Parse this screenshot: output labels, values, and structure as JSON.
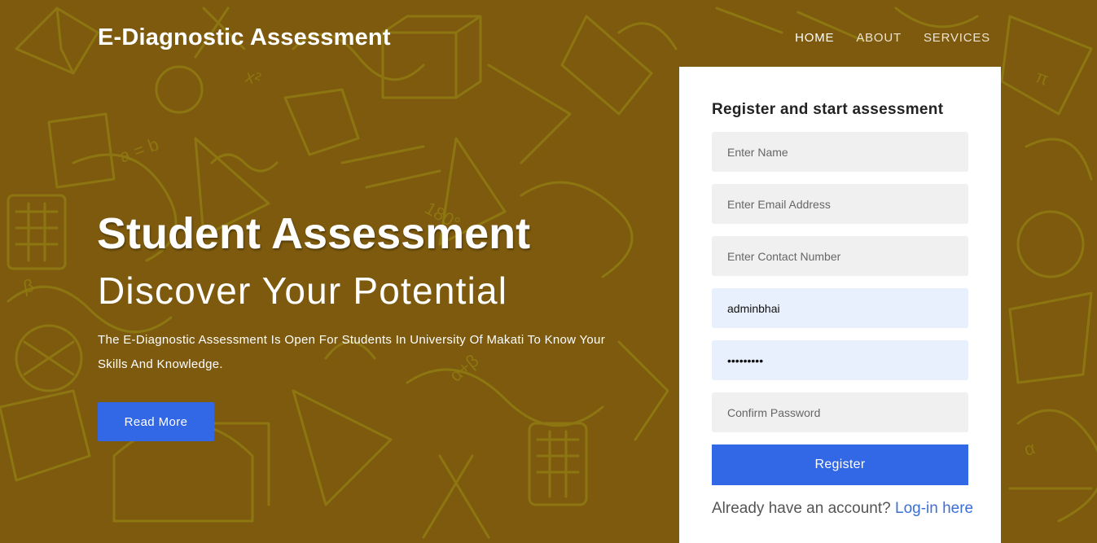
{
  "header": {
    "brand": "E-Diagnostic Assessment",
    "nav": [
      {
        "label": "HOME",
        "active": true
      },
      {
        "label": "ABOUT",
        "active": false
      },
      {
        "label": "SERVICES",
        "active": false
      }
    ]
  },
  "hero": {
    "title": "Student Assessment",
    "subtitle": "Discover Your Potential",
    "description": "The E-Diagnostic Assessment Is Open For Students In University Of Makati To Know Your Skills And Knowledge.",
    "read_more_label": "Read More"
  },
  "register_form": {
    "title": "Register and start assessment",
    "name": {
      "placeholder": "Enter Name",
      "value": ""
    },
    "email": {
      "placeholder": "Enter Email Address",
      "value": ""
    },
    "contact": {
      "placeholder": "Enter Contact Number",
      "value": ""
    },
    "username": {
      "placeholder": "",
      "value": "adminbhai"
    },
    "password": {
      "placeholder": "",
      "value": "passwordx"
    },
    "confirm_password": {
      "placeholder": "Confirm Password",
      "value": ""
    },
    "register_label": "Register",
    "login_prompt": "Already have an account?",
    "login_link": "Log-in here"
  },
  "colors": {
    "background": "#7d5a0e",
    "doodle": "#8f7a12",
    "accent": "#3268e6",
    "link": "#3a6fd8",
    "field_bg": "#f0f0f0",
    "autofill_bg": "#e8f0fe"
  }
}
